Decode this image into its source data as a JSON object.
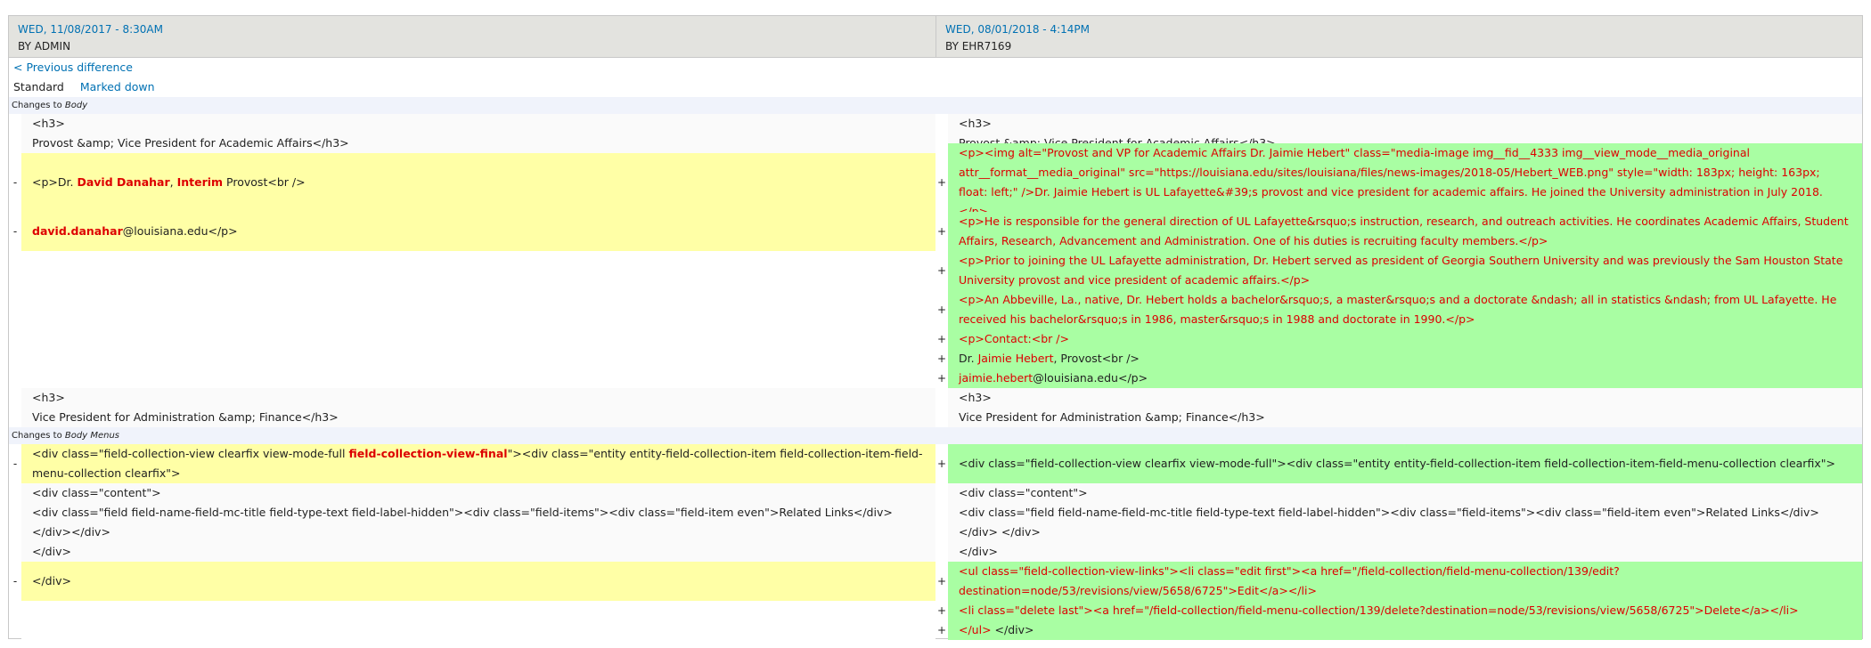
{
  "header": {
    "left": {
      "date": "WED, 11/08/2017 - 8:30AM",
      "by": "BY ADMIN"
    },
    "right": {
      "date": "WED, 08/01/2018 - 4:14PM",
      "by": "BY EHR7169"
    }
  },
  "nav": {
    "previous": "< Previous difference",
    "mode_standard": "Standard",
    "mode_markdown": "Marked down"
  },
  "sections": {
    "body": {
      "prefix": "Changes to ",
      "field": "Body"
    },
    "menus": {
      "prefix": "Changes to ",
      "field": "Body Menus"
    }
  },
  "markers": {
    "minus": "-",
    "plus": "+"
  },
  "body": {
    "h3_open": "<h3>",
    "provost_title": "Provost &amp; Vice President for Academic Affairs</h3>",
    "left_p1_a": "<p>Dr. ",
    "left_p1_b": "David Danahar",
    "left_p1_c": ", ",
    "left_p1_d": "Interim",
    "left_p1_e": " Provost<br />",
    "left_p2_a": "david.danahar",
    "left_p2_b": "@louisiana.edu</p>",
    "right_img_a": "<p>",
    "right_img_b": "<img alt=\"Provost and VP for Academic Affairs Dr. Jaimie Hebert\" class=\"media-image img__fid__4333 img__view_mode__media_original attr__format__media_original\" src=\"https://louisiana.edu/sites/louisiana/files/news-images/2018-05/Hebert_WEB.png\" style=\"width: 183px; height: 163px; float: left;\" />Dr. Jaimie Hebert is UL Lafayette&#39;s provost and vice president for academic affairs. He joined the University administration in July 2018.</p>",
    "right_p_general": "<p>He is responsible for the general direction of UL Lafayette&rsquo;s instruction, research, and outreach activities. He coordinates Academic Affairs, Student Affairs, Research, Advancement and Administration. One of his duties is recruiting faculty members.</p>",
    "right_p_prior": "<p>Prior to joining the UL Lafayette administration, Dr. Hebert served as president of Georgia Southern University and was previously the Sam Houston State University provost and vice president of academic affairs.</p>",
    "right_p_abbeville": "<p>An Abbeville, La., native, Dr. Hebert holds a bachelor&rsquo;s, a master&rsquo;s and a doctorate &ndash; all in statistics &ndash; from UL Lafayette. He received his bachelor&rsquo;s in 1986, master&rsquo;s in 1988 and doctorate in 1990.</p>",
    "right_contact": "<p>Contact:<br />",
    "right_dr_a": "Dr. ",
    "right_dr_b": "Jaimie Hebert",
    "right_dr_c": ", Provost<br />",
    "right_email_a": "jaimie.hebert",
    "right_email_b": "@louisiana.edu</p>",
    "vp_admin_title": "Vice President for Administration &amp; Finance</h3>"
  },
  "menus": {
    "left_div_a": "<div class=\"field-collection-view clearfix view-mode-full ",
    "left_div_b": "field-collection-view-final",
    "left_div_c": "\"><div class=\"entity entity-field-collection-item field-collection-item-field-menu-collection clearfix\">",
    "right_div": "<div class=\"field-collection-view clearfix view-mode-full\"><div class=\"entity entity-field-collection-item field-collection-item-field-menu-collection clearfix\">",
    "content_div": "<div class=\"content\">",
    "field_left": "<div class=\"field field-name-field-mc-title field-type-text field-label-hidden\"><div class=\"field-items\"><div class=\"field-item even\">Related Links</div></div></div>",
    "field_right": "<div class=\"field field-name-field-mc-title field-type-text field-label-hidden\"><div class=\"field-items\"><div class=\"field-item even\">Related Links</div></div> </div>",
    "close_div": "</div>",
    "right_ul": "<ul class=\"field-collection-view-links\"><li class=\"edit first\"><a href=\"/field-collection/field-menu-collection/139/edit?destination=node/53/revisions/view/5658/6725\">Edit</a></li>",
    "right_li_delete": "<li class=\"delete last\"><a href=\"/field-collection/field-menu-collection/139/delete?destination=node/53/revisions/view/5658/6725\">Delete</a></li>",
    "right_ul_close_a": "</ul>",
    "right_ul_close_b": " </div>"
  }
}
